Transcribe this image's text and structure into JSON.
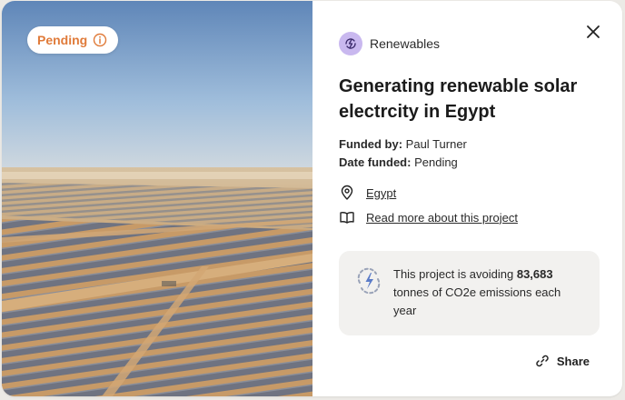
{
  "status": {
    "label": "Pending",
    "icon": "info-icon",
    "color": "#e07b3a"
  },
  "category": {
    "label": "Renewables",
    "icon": "renewables-icon",
    "icon_bg": "#c9b8ef"
  },
  "title": "Generating renewable solar electrcity in Egypt",
  "funding": {
    "funded_by_label": "Funded by:",
    "funded_by_value": "Paul Turner",
    "date_funded_label": "Date funded:",
    "date_funded_value": "Pending"
  },
  "links": {
    "location": {
      "label": "Egypt",
      "icon": "map-pin-icon"
    },
    "read_more": {
      "label": "Read more about this project",
      "icon": "book-icon"
    }
  },
  "impact": {
    "text_before": "This project is avoiding ",
    "amount": "83,683",
    "text_after": " tonnes of CO2e emissions each year",
    "icon": "lightning-recycle-icon"
  },
  "share": {
    "label": "Share",
    "icon": "link-icon"
  },
  "close": {
    "icon": "close-icon"
  }
}
